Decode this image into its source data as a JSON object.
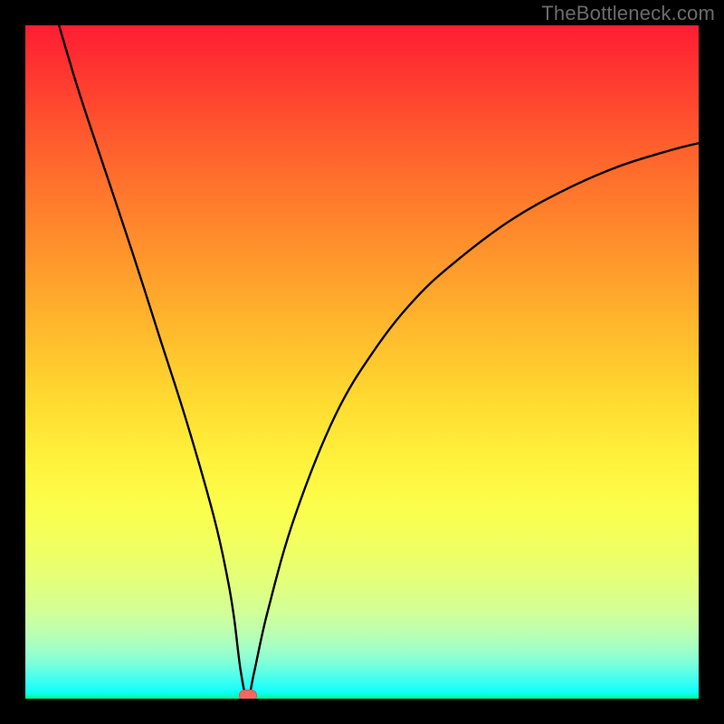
{
  "watermark": "TheBottleneck.com",
  "chart_data": {
    "type": "line",
    "title": "",
    "xlabel": "",
    "ylabel": "",
    "xlim": [
      0,
      100
    ],
    "ylim": [
      0,
      100
    ],
    "grid": false,
    "legend": false,
    "series": [
      {
        "name": "bottleneck-curve",
        "x": [
          5,
          8,
          12,
          16,
          20,
          24,
          28,
          30,
          31,
          32,
          33,
          34,
          36,
          40,
          46,
          52,
          58,
          64,
          72,
          80,
          88,
          96,
          100
        ],
        "values": [
          100,
          90,
          78,
          66,
          53.5,
          41,
          27,
          18,
          12,
          4,
          0,
          4,
          13,
          27,
          42,
          52,
          59.5,
          65,
          71,
          75.5,
          79,
          81.5,
          82.5
        ]
      }
    ],
    "marker": {
      "x": 33,
      "y": 0,
      "name": "optimal-point"
    },
    "background": {
      "type": "vertical-gradient",
      "stops": [
        {
          "pos": 0,
          "color": "#ff1d32"
        },
        {
          "pos": 50,
          "color": "#ffcf2e"
        },
        {
          "pos": 72,
          "color": "#fbff4d"
        },
        {
          "pos": 90,
          "color": "#bdffb0"
        },
        {
          "pos": 100,
          "color": "#00ff91"
        }
      ]
    }
  },
  "colors": {
    "frame": "#000000",
    "curve": "#000000",
    "marker": "#f06a5d",
    "watermark": "#6b6b6b"
  }
}
